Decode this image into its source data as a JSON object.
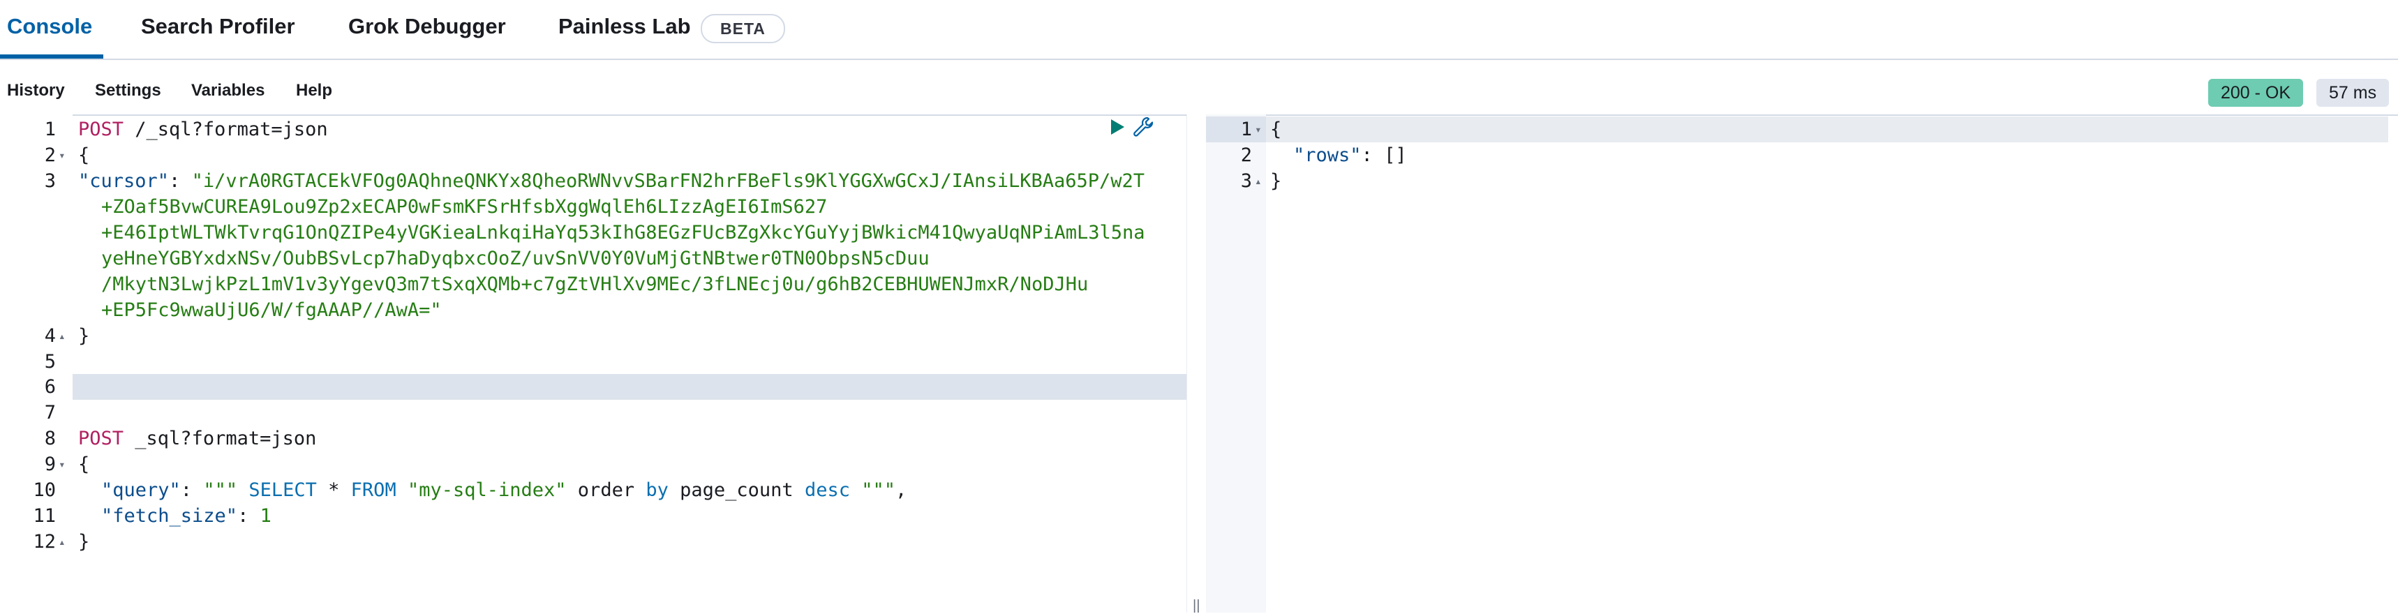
{
  "tabs": [
    {
      "label": "Console",
      "active": true
    },
    {
      "label": "Search Profiler",
      "active": false
    },
    {
      "label": "Grok Debugger",
      "active": false
    },
    {
      "label": "Painless Lab",
      "active": false
    }
  ],
  "beta_badge": "BETA",
  "toolbar": {
    "history": "History",
    "settings": "Settings",
    "variables": "Variables",
    "help": "Help"
  },
  "response_status": {
    "code_text": "200 - OK",
    "time": "57 ms"
  },
  "request_editor": {
    "line_numbers": [
      "1",
      "2",
      "3",
      "4",
      "5",
      "6",
      "7",
      "8",
      "9",
      "10",
      "11",
      "12"
    ],
    "line1": {
      "method": "POST",
      "path": " /_sql?format=json"
    },
    "line2": "{",
    "line3": {
      "key": "\"cursor\"",
      "colon": ": ",
      "value": "\"i/vrA0RGTACEkVFOg0AQhneQNKYx8QheoRWNvvSBarFN2hrFBeFls9KlYGGXwGCxJ/IAnsiLKBAa65P/w2T"
    },
    "line3_wraps": [
      "+ZOaf5BvwCUREA9Lou9Zp2xECAP0wFsmKFSrHfsbXggWqlEh6LIzzAgEI6ImS627",
      "+E46IptWLTWkTvrqG1OnQZIPe4yVGKieaLnkqiHaYq53kIhG8EGzFUcBZgXkcYGuYyjBWkicM41QwyaUqNPiAmL3l5na",
      "yeHneYGBYxdxNSv/OubBSvLcp7haDyqbxcOoZ/uvSnVV0Y0VuMjGtNBtwer0TN0ObpsN5cDuu",
      "/MkytN3LwjkPzL1mV1v3yYgevQ3m7tSxqXQMb+c7gZtVHlXv9MEc/3fLNEcj0u/g6hB2CEBHUWENJmxR/NoDJHu",
      "+EP5Fc9wwaUjU6/W/fgAAAP//AwA=\""
    ],
    "line4": "}",
    "line8": {
      "method": "POST",
      "path": " _sql?format=json"
    },
    "line9": "{",
    "line10": {
      "key": "\"query\"",
      "colon": ": ",
      "triple_open": "\"\"\"",
      "sql_select": " SELECT",
      "sql_star": " * ",
      "sql_from": "FROM",
      "sql_index": " \"my-sql-index\"",
      "sql_order": " order ",
      "sql_by": "by",
      "sql_field": " page_count ",
      "sql_desc": "desc",
      "triple_close": " \"\"\"",
      "comma": ","
    },
    "line11": {
      "key": "\"fetch_size\"",
      "colon": ": ",
      "value": "1"
    },
    "line12": "}"
  },
  "response_editor": {
    "line_numbers": [
      "1",
      "2",
      "3"
    ],
    "line1": "{",
    "line2": {
      "key": "\"rows\"",
      "colon": ": ",
      "value": "[]"
    },
    "line3": "}"
  },
  "colors": {
    "accent": "#0061a6",
    "status_ok": "#6dccb1",
    "method": "#b12060",
    "string": "#267d14"
  }
}
